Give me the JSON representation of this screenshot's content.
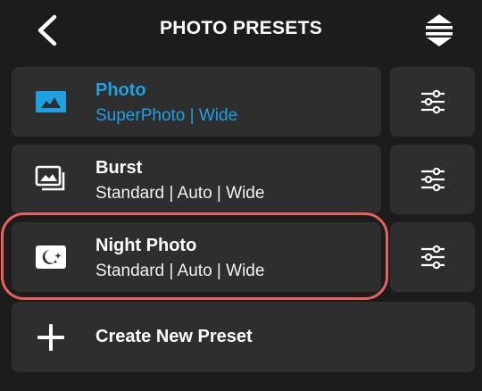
{
  "header": {
    "title": "PHOTO PRESETS",
    "back_icon": "chevron-left-icon",
    "sort_icon": "reorder-icon"
  },
  "presets": [
    {
      "name": "Photo",
      "detail": "SuperPhoto | Wide",
      "icon": "photo-icon",
      "selected": true
    },
    {
      "name": "Burst",
      "detail": "Standard | Auto | Wide",
      "icon": "burst-icon",
      "selected": false
    },
    {
      "name": "Night Photo",
      "detail": "Standard | Auto | Wide",
      "icon": "night-photo-icon",
      "selected": false,
      "highlighted": true
    }
  ],
  "create": {
    "label": "Create New Preset",
    "icon": "plus-icon"
  },
  "colors": {
    "background": "#1c1c1c",
    "card": "#2e2e2e",
    "accent": "#1ea1e2",
    "highlight": "#e8625d",
    "text": "#ffffff"
  }
}
